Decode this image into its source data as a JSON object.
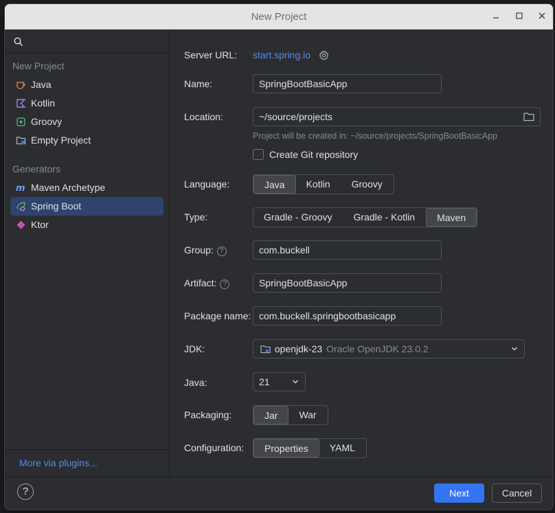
{
  "window": {
    "title": "New Project"
  },
  "sidebar": {
    "search_placeholder": "",
    "section_new_project": "New Project",
    "new_project_items": [
      {
        "label": "Java",
        "icon": "java-cup-icon"
      },
      {
        "label": "Kotlin",
        "icon": "kotlin-icon"
      },
      {
        "label": "Groovy",
        "icon": "groovy-icon"
      },
      {
        "label": "Empty Project",
        "icon": "empty-project-icon"
      }
    ],
    "section_generators": "Generators",
    "generator_items": [
      {
        "label": "Maven Archetype",
        "icon": "maven-icon"
      },
      {
        "label": "Spring Boot",
        "icon": "spring-boot-icon",
        "selected": true
      },
      {
        "label": "Ktor",
        "icon": "ktor-icon"
      }
    ],
    "more_plugins": "More via plugins..."
  },
  "form": {
    "server_url_label": "Server URL:",
    "server_url_value": "start.spring.io",
    "name_label": "Name:",
    "name_value": "SpringBootBasicApp",
    "location_label": "Location:",
    "location_value": "~/source/projects",
    "location_hint": "Project will be created in: ~/source/projects/SpringBootBasicApp",
    "git_checkbox_label": "Create Git repository",
    "git_checked": false,
    "language_label": "Language:",
    "language_options": [
      "Java",
      "Kotlin",
      "Groovy"
    ],
    "language_selected": "Java",
    "type_label": "Type:",
    "type_options": [
      "Gradle - Groovy",
      "Gradle - Kotlin",
      "Maven"
    ],
    "type_selected": "Maven",
    "group_label": "Group:",
    "group_value": "com.buckell",
    "artifact_label": "Artifact:",
    "artifact_value": "SpringBootBasicApp",
    "package_label": "Package name:",
    "package_value": "com.buckell.springbootbasicapp",
    "jdk_label": "JDK:",
    "jdk_name": "openjdk-23",
    "jdk_detail": "Oracle OpenJDK 23.0.2",
    "java_label": "Java:",
    "java_value": "21",
    "packaging_label": "Packaging:",
    "packaging_options": [
      "Jar",
      "War"
    ],
    "packaging_selected": "Jar",
    "configuration_label": "Configuration:",
    "configuration_options": [
      "Properties",
      "YAML"
    ],
    "configuration_selected": "Properties"
  },
  "footer": {
    "help": "?",
    "next_label": "Next",
    "cancel_label": "Cancel"
  },
  "colors": {
    "accent": "#3574f0",
    "link": "#548af7",
    "selected_nav": "#2e436e",
    "dialog_bg": "#2b2d30"
  }
}
